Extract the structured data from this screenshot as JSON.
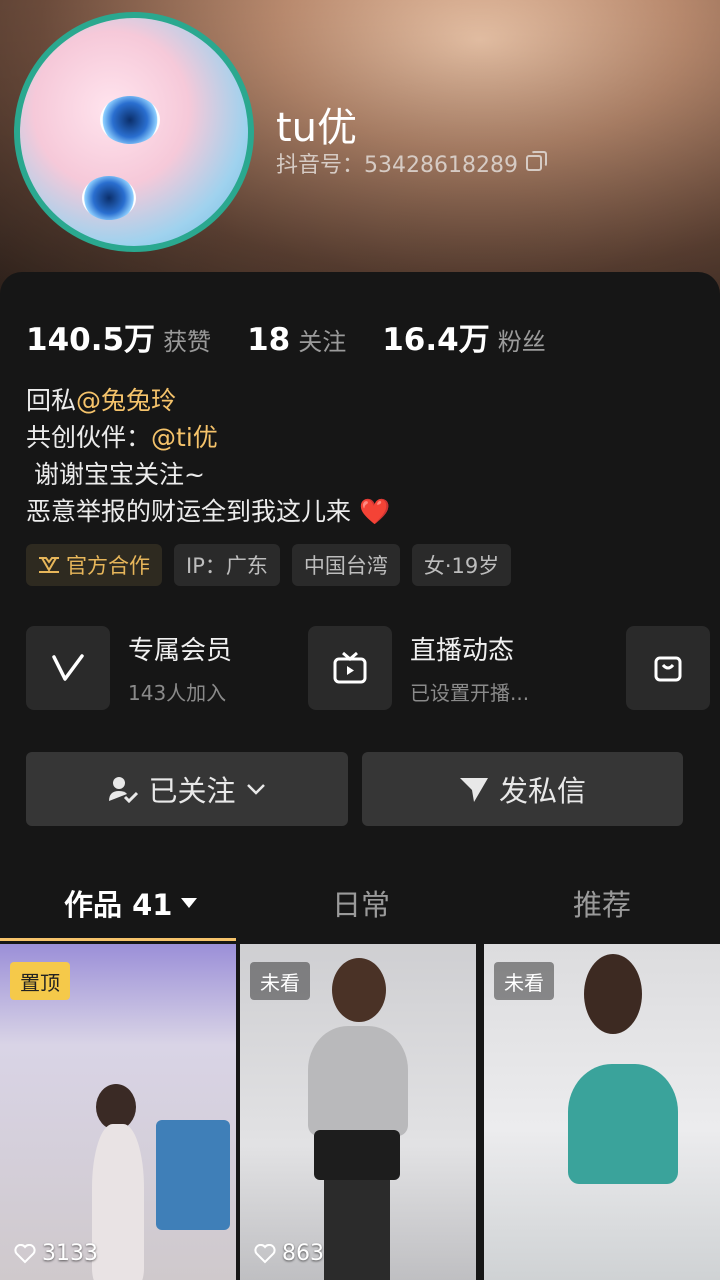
{
  "profile": {
    "name": "tu优",
    "douyin_id": "抖音号：53428618289"
  },
  "stats": [
    {
      "value": "140.5万",
      "label": "获赞"
    },
    {
      "value": "18",
      "label": "关注"
    },
    {
      "value": "16.4万",
      "label": "粉丝"
    }
  ],
  "bio": {
    "line1_prefix": "回私",
    "line1_mention": "@兔兔玲",
    "line2_prefix": "共创伙伴：",
    "line2_mention": "@ti优",
    "line3": " 谢谢宝宝关注~",
    "line4": "恶意举报的财运全到我这儿来",
    "line4_emoji": "❤️"
  },
  "tags": [
    "官方合作",
    "IP：广东",
    "中国台湾",
    "女·19岁"
  ],
  "features": [
    {
      "title": "专属会员",
      "subtitle": "143人加入"
    },
    {
      "title": "直播动态",
      "subtitle": "已设置开播..."
    }
  ],
  "actions": {
    "follow": "已关注",
    "message": "发私信"
  },
  "tabs": [
    {
      "label": "作品 41"
    },
    {
      "label": "日常"
    },
    {
      "label": "推荐"
    }
  ],
  "videos": [
    {
      "badge": "置顶",
      "likes": "3133"
    },
    {
      "badge": "未看",
      "likes": "863"
    },
    {
      "badge": "未看",
      "likes": ""
    }
  ],
  "colors": {
    "accent_gold": "#f5c36b",
    "background": "#161616",
    "button": "#363636"
  }
}
